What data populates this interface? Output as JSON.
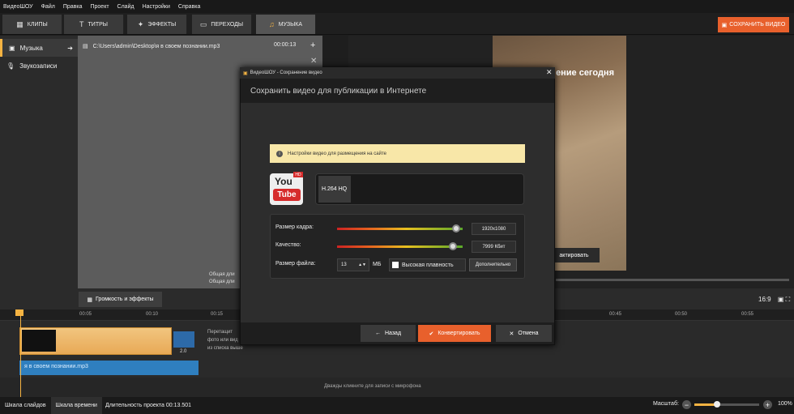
{
  "app": {
    "logo": "ВидеоШОУ"
  },
  "menu": [
    "Файл",
    "Правка",
    "Проект",
    "Слайд",
    "Настройки",
    "Справка"
  ],
  "tabs": [
    {
      "label": "КЛИПЫ",
      "icon": "film-icon"
    },
    {
      "label": "ТИТРЫ",
      "icon": "text-icon"
    },
    {
      "label": "ЭФФЕКТЫ",
      "icon": "effects-icon"
    },
    {
      "label": "ПЕРЕХОДЫ",
      "icon": "transition-icon"
    },
    {
      "label": "МУЗЫКА",
      "icon": "music-icon"
    }
  ],
  "save_video": "СОХРАНИТЬ ВИДЕО",
  "sidebar": [
    {
      "label": "Музыка",
      "icon": "music-icon"
    },
    {
      "label": "Звукозаписи",
      "icon": "mic-icon"
    }
  ],
  "track": {
    "path": "C:\\Users\\admin\\Desktop\\я в своем познании.mp3",
    "time": "00:00:13"
  },
  "left_duration": [
    "Общая дли",
    "Общая дли"
  ],
  "preview": {
    "overlay_text": "ение сегодня",
    "edit_button": "актировать"
  },
  "fx_button": "Громкость и эффекты",
  "ratio": "16:9",
  "ruler_ticks": [
    "00:05",
    "00:10",
    "00:15",
    "00:45",
    "00:50",
    "00:55"
  ],
  "transition_value": "2.0",
  "drop_hint": [
    "Перетащит",
    "фото или вид",
    "из списка выше"
  ],
  "audio_clip": "я в своем познании.mp3",
  "mic_hint": "Дважды кликните для записи с микрофона",
  "status": {
    "tab1": "Шкала слайдов",
    "tab2": "Шкала времени",
    "duration": "Длительность проекта 00:13.501",
    "zoom_label": "Масштаб:",
    "zoom_pct": "100%",
    "zoom_value": 0.35
  },
  "dialog": {
    "title": "ВидеоШОУ - Сохранение видео",
    "header": "Сохранить видео для публикации в Интернете",
    "notice": "Настройки видео для размещения на сайте",
    "format": "H.264 HQ",
    "yt_top": "You",
    "yt_bottom": "Tube",
    "yt_hd": "HD",
    "frame_label": "Размер кадра:",
    "frame_value": "1920x1080",
    "frame_level": 0.95,
    "quality_label": "Качество:",
    "quality_value": "7999 Кбит",
    "quality_level": 0.92,
    "filesize_label": "Размер файла:",
    "filesize_value": "13",
    "filesize_unit": "МБ",
    "smooth_label": "Высокая плавность",
    "advanced": "Дополнительно",
    "back": "Назад",
    "convert": "Конвертировать",
    "cancel": "Отмена"
  }
}
